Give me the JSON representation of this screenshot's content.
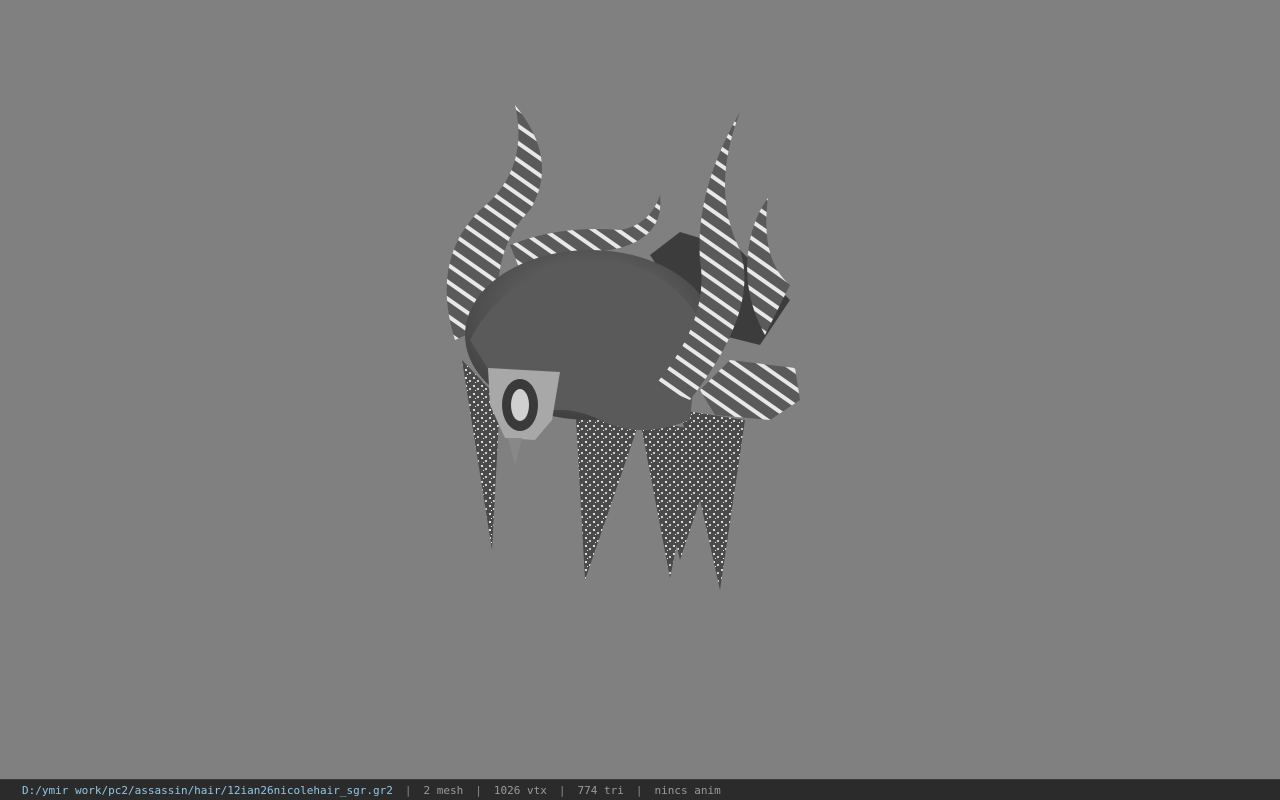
{
  "viewport": {
    "background_color": "#808080",
    "model_icon": "horned-hair-model"
  },
  "status_bar": {
    "file_path": "D:/ymir work/pc2/assassin/hair/12ian26nicolehair_sgr.gr2",
    "separator": "|",
    "mesh_count": "2 mesh",
    "vertex_count": "1026 vtx",
    "triangle_count": "774 tri",
    "animation": "nincs anim",
    "path_color": "#8fc6e6"
  }
}
